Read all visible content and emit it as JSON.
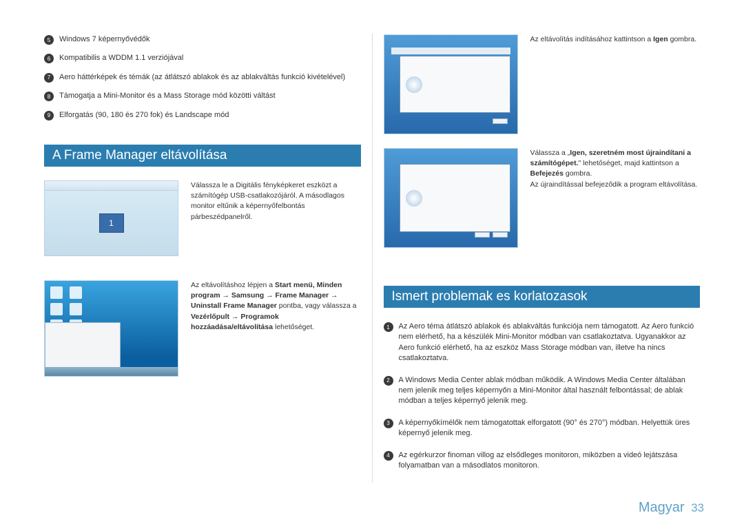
{
  "features": [
    {
      "n": "5",
      "text": "Windows 7 képernyővédők"
    },
    {
      "n": "6",
      "text": "Kompatibilis a WDDM 1.1 verziójával"
    },
    {
      "n": "7",
      "text": "Aero háttérképek és témák (az átlátszó ablakok és az ablakváltás funkció kivételével)"
    },
    {
      "n": "8",
      "text": "Támogatja a Mini-Monitor és a Mass Storage mód közötti váltást"
    },
    {
      "n": "9",
      "text": "Elforgatás (90, 180 és 270 fok) és Landscape mód"
    }
  ],
  "section1_title": "A Frame Manager eltávolítása",
  "block1_text": "Válassza le a Digitális fényképkeret eszközt a számítógép USB-csatlakozójáról. A másodlagos monitor eltűnik a képernyőfelbontás párbeszédpanelről.",
  "block2_prefix": "Az eltávolításhoz lépjen a ",
  "block2_bold1": "Start menü, Minden program → Samsung → Frame Manager → Uninstall Frame Manager",
  "block2_mid": " pontba, vagy válassza a ",
  "block2_bold2": "Vezérlőpult → Programok hozzáadása/eltávolítása",
  "block2_suffix": " lehetőséget.",
  "right_caption1_pre": "Az eltávolítás indításához kattintson a ",
  "right_caption1_bold": "Igen",
  "right_caption1_post": " gombra.",
  "right_caption2_line1_pre": "Válassza a „",
  "right_caption2_line1_bold": "Igen, szeretném most újraindítani a számítógépet.",
  "right_caption2_line1_post": "\" lehetőséget, majd kattintson a ",
  "right_caption2_line2_bold": "Befejezés",
  "right_caption2_line2_post": " gombra.",
  "right_caption2_line3": "Az újraindítással befejeződik a program eltávolítása.",
  "section2_title": "Ismert problemak es korlatozasok",
  "issues": [
    {
      "n": "1",
      "text": "Az Aero téma átlátszó ablakok és ablakváltás funkciója nem támogatott. Az Aero funkció nem elérhető, ha a készülék Mini-Monitor módban van csatlakoztatva. Ugyanakkor az Aero funkció elérhető, ha az eszköz Mass Storage módban van, illetve ha nincs csatlakoztatva."
    },
    {
      "n": "2",
      "text": "A Windows Media Center ablak módban működik. A Windows Media Center általában nem jelenik meg teljes képernyőn a Mini-Monitor által használt felbontással; de ablak módban a teljes képernyő jelenik meg."
    },
    {
      "n": "3",
      "text": "A képernyőkímélők nem támogatottak elforgatott (90° és 270°) módban. Helyettük üres képernyő jelenik meg."
    },
    {
      "n": "4",
      "text": "Az egérkurzor finoman villog az elsődleges monitoron, miközben a videó lejátszása folyamatban van a másodlatos monitoron."
    }
  ],
  "footer_lang": "Magyar",
  "footer_page": "33"
}
